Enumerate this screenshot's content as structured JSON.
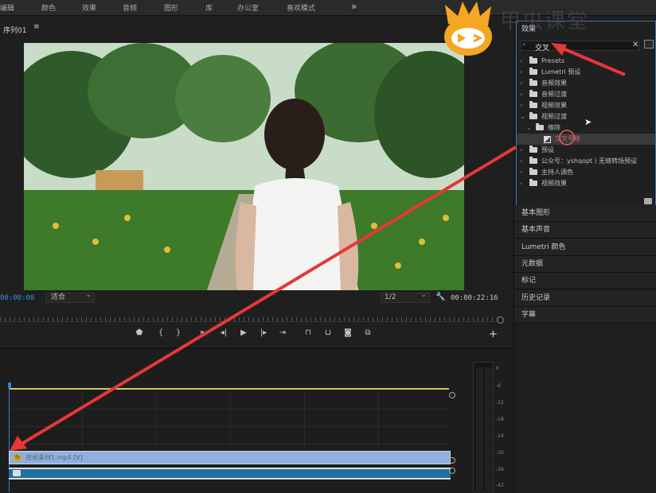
{
  "menu": {
    "tabs": [
      "编辑",
      "颜色",
      "效果",
      "音频",
      "图形",
      "库",
      "办公室",
      "喜欢模式"
    ],
    "overflow": "»"
  },
  "watermark": {
    "brand": "甲虫课堂"
  },
  "program_monitor": {
    "title": "序列01",
    "menu_icon": "≡",
    "timecode_current": "00:00:00",
    "fit_label": "适合",
    "resolution_label": "1/2",
    "timecode_duration": "00:00:22:16",
    "controls": [
      "marker-icon",
      "in-point-icon",
      "out-point-icon",
      "go-to-in-icon",
      "step-back-icon",
      "play-icon",
      "step-forward-icon",
      "go-to-out-icon",
      "lift-icon",
      "extract-icon",
      "export-frame-icon",
      "comparison-icon"
    ],
    "add_button": "+"
  },
  "timeline": {
    "video_clip_name": "视频素材1.mp4 [V]",
    "meter_labels": [
      "0",
      "-6",
      "-12",
      "-18",
      "-24",
      "-30",
      "-36",
      "-42"
    ]
  },
  "effects_panel": {
    "title": "效果",
    "search_value": "交叉",
    "tree": [
      {
        "label": "Presets",
        "level": 0,
        "type": "folder"
      },
      {
        "label": "Lumetri 预设",
        "level": 0,
        "type": "folder"
      },
      {
        "label": "音频效果",
        "level": 0,
        "type": "folder"
      },
      {
        "label": "音频过渡",
        "level": 0,
        "type": "folder"
      },
      {
        "label": "视频效果",
        "level": 0,
        "type": "folder"
      },
      {
        "label": "视频过渡",
        "level": 0,
        "type": "folder",
        "expanded": true
      },
      {
        "label": "擦除",
        "level": 1,
        "type": "folder",
        "expanded": true
      },
      {
        "label": "交叉平移",
        "level": 2,
        "type": "effect",
        "selected": true
      },
      {
        "label": "预设",
        "level": 0,
        "type": "folder"
      },
      {
        "label": "公众号：yshqopt丨无缝转场预设",
        "level": 0,
        "type": "folder"
      },
      {
        "label": "主持人调色",
        "level": 0,
        "type": "folder"
      },
      {
        "label": "视频效果",
        "level": 0,
        "type": "folder"
      }
    ]
  },
  "side_panels": [
    "基本图形",
    "基本声音",
    "Lumetri 颜色",
    "元数据",
    "标记",
    "历史记录",
    "字幕"
  ],
  "colors": {
    "accent_blue": "#2d7fe0",
    "annotation_red": "#e8363a",
    "panel_border": "#3b6fb8"
  }
}
